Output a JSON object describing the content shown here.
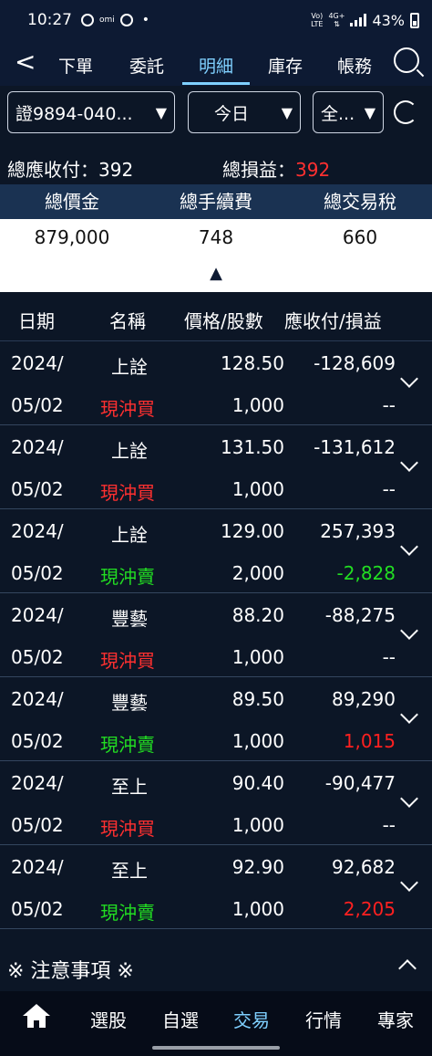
{
  "status_bar": {
    "time": "10:27",
    "omi": "omi",
    "net_top": "Vo)",
    "net_bottom": "LTE",
    "net_type": "4G+",
    "battery": "43%"
  },
  "nav": {
    "back": "<",
    "tabs": [
      "下單",
      "委託",
      "明細",
      "庫存",
      "帳務"
    ],
    "active_tab": "明細"
  },
  "filters": {
    "account": "證9894-040...",
    "date": "今日",
    "type": "全..."
  },
  "summary": {
    "receivable_label": "總應收付：",
    "receivable_value": "392",
    "pnl_label": "總損益：",
    "pnl_value": "392"
  },
  "totals": {
    "headers": [
      "總價金",
      "總手續費",
      "總交易稅"
    ],
    "values": [
      "879,000",
      "748",
      "660"
    ],
    "collapse": "▲"
  },
  "table": {
    "headers": [
      "日期",
      "名稱",
      "價格/股數",
      "應收付/損益"
    ],
    "rows": [
      {
        "date1": "2024/",
        "date2": "05/02",
        "name": "上詮",
        "action": "現沖買",
        "action_color": "#ff3030",
        "price": "128.50",
        "shares": "1,000",
        "amount": "-128,609",
        "pnl": "--",
        "pnl_color": "#ffffff"
      },
      {
        "date1": "2024/",
        "date2": "05/02",
        "name": "上詮",
        "action": "現沖買",
        "action_color": "#ff3030",
        "price": "131.50",
        "shares": "1,000",
        "amount": "-131,612",
        "pnl": "--",
        "pnl_color": "#ffffff"
      },
      {
        "date1": "2024/",
        "date2": "05/02",
        "name": "上詮",
        "action": "現沖賣",
        "action_color": "#22dd22",
        "price": "129.00",
        "shares": "2,000",
        "amount": "257,393",
        "pnl": "-2,828",
        "pnl_color": "#22dd22"
      },
      {
        "date1": "2024/",
        "date2": "05/02",
        "name": "豐藝",
        "action": "現沖買",
        "action_color": "#ff3030",
        "price": "88.20",
        "shares": "1,000",
        "amount": "-88,275",
        "pnl": "--",
        "pnl_color": "#ffffff"
      },
      {
        "date1": "2024/",
        "date2": "05/02",
        "name": "豐藝",
        "action": "現沖賣",
        "action_color": "#22dd22",
        "price": "89.50",
        "shares": "1,000",
        "amount": "89,290",
        "pnl": "1,015",
        "pnl_color": "#ff2020"
      },
      {
        "date1": "2024/",
        "date2": "05/02",
        "name": "至上",
        "action": "現沖買",
        "action_color": "#ff3030",
        "price": "90.40",
        "shares": "1,000",
        "amount": "-90,477",
        "pnl": "--",
        "pnl_color": "#ffffff"
      },
      {
        "date1": "2024/",
        "date2": "05/02",
        "name": "至上",
        "action": "現沖賣",
        "action_color": "#22dd22",
        "price": "92.90",
        "shares": "1,000",
        "amount": "92,682",
        "pnl": "2,205",
        "pnl_color": "#ff2020"
      }
    ]
  },
  "notice": {
    "title": "※ 注意事項 ※"
  },
  "bottom_nav": {
    "items": [
      "選股",
      "自選",
      "交易",
      "行情",
      "專家"
    ],
    "active": "交易"
  },
  "colors": {
    "accent": "#7fd0ff",
    "background": "#0c1626",
    "header_band": "#1a3252",
    "buy": "#ff3030",
    "sell": "#22dd22"
  }
}
